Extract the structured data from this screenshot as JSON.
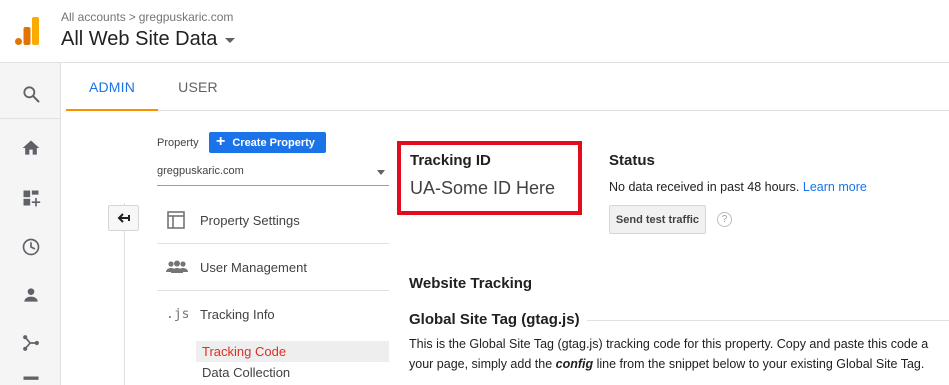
{
  "header": {
    "breadcrumb": {
      "root": "All accounts",
      "separator": ">",
      "account": "gregpuskaric.com"
    },
    "view_title": "All Web Site Data"
  },
  "leftnav": {
    "items": [
      {
        "icon": "search-icon"
      },
      {
        "icon": "home-icon"
      },
      {
        "icon": "customization-icon"
      },
      {
        "icon": "realtime-clock-icon"
      },
      {
        "icon": "audience-person-icon"
      },
      {
        "icon": "acquisition-icon"
      }
    ]
  },
  "tabs": [
    {
      "label": "ADMIN",
      "active": true
    },
    {
      "label": "USER",
      "active": false
    }
  ],
  "property": {
    "label": "Property",
    "create_button": "Create Property",
    "selected": "gregpuskaric.com",
    "menu": [
      {
        "label": "Property Settings",
        "icon": "property-settings-icon"
      },
      {
        "label": "User Management",
        "icon": "user-management-icon"
      },
      {
        "label": "Tracking Info",
        "icon": "js-icon",
        "icon_text": ".js"
      }
    ],
    "submenu": [
      {
        "label": "Tracking Code",
        "active": true
      },
      {
        "label": "Data Collection",
        "active": false
      }
    ]
  },
  "tracking": {
    "label": "Tracking ID",
    "value": "UA-Some ID Here",
    "highlight_color": "#e30c1b"
  },
  "status": {
    "title": "Status",
    "text": "No data received in past 48 hours.",
    "link": "Learn more",
    "button": "Send test traffic",
    "help": "?"
  },
  "website_tracking": {
    "title": "Website Tracking",
    "gst_title": "Global Site Tag (gtag.js)",
    "desc_line1": "This is the Global Site Tag (gtag.js) tracking code for this property. Copy and paste this code a",
    "desc_line2_a": "your page, simply add the ",
    "desc_line2_em": "config",
    "desc_line2_b": " line from the snippet below to your existing Global Site Tag."
  },
  "colors": {
    "accent_blue": "#1a73e8",
    "tab_underline": "#ff8f00",
    "active_subitem": "#d93025"
  }
}
